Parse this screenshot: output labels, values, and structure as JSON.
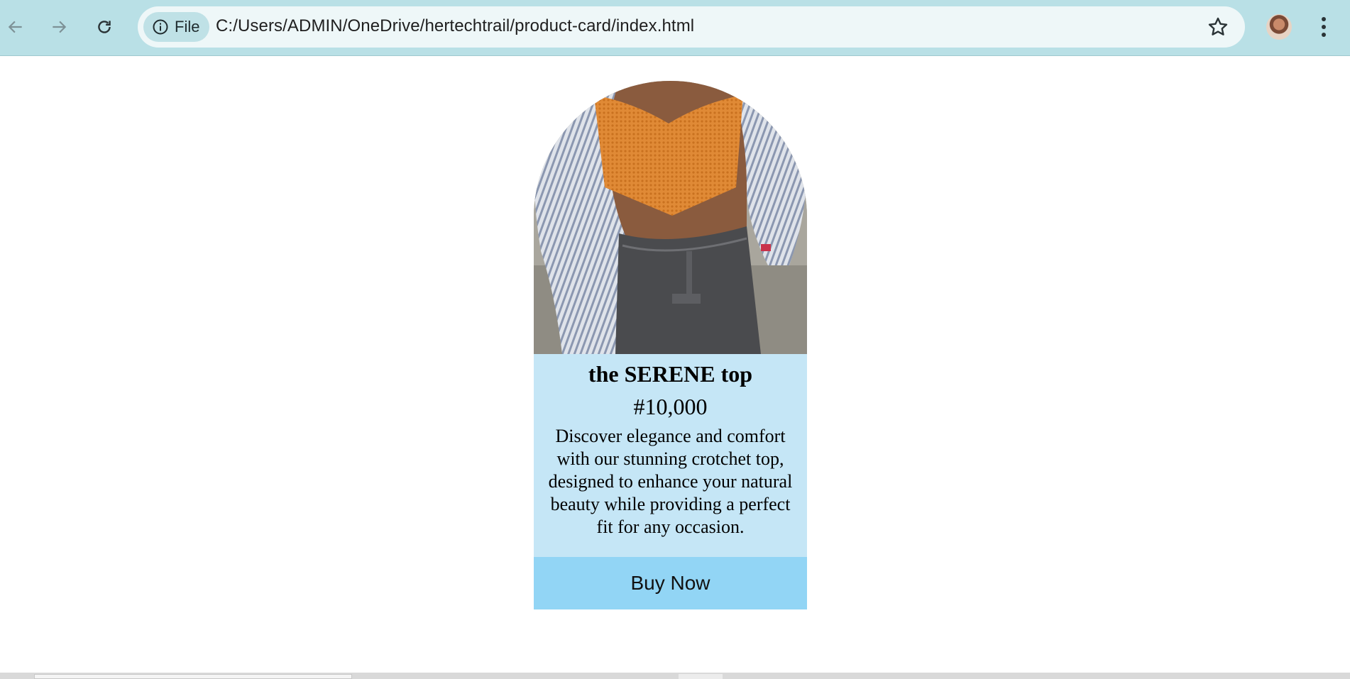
{
  "browser": {
    "site_chip_label": "File",
    "url": "C:/Users/ADMIN/OneDrive/hertechtrail/product-card/index.html",
    "icons": {
      "back": "back-arrow-icon",
      "forward": "forward-arrow-icon",
      "reload": "reload-icon",
      "site_info": "info-icon",
      "bookmark": "star-icon",
      "profile": "avatar",
      "menu": "kebab-menu-icon"
    },
    "colors": {
      "toolbar": "#b9e0e6",
      "omnibox": "#eef7f8"
    }
  },
  "product": {
    "image_alt": "",
    "title": "the SERENE top",
    "price": "#10,000",
    "description": "Discover elegance and comfort with our stunning crotchet top, designed to enhance your natural beauty while providing a perfect fit for any occasion.",
    "button_label": "Buy Now",
    "colors": {
      "body_bg": "#c5e6f6",
      "button_bg": "#92d5f5"
    }
  }
}
